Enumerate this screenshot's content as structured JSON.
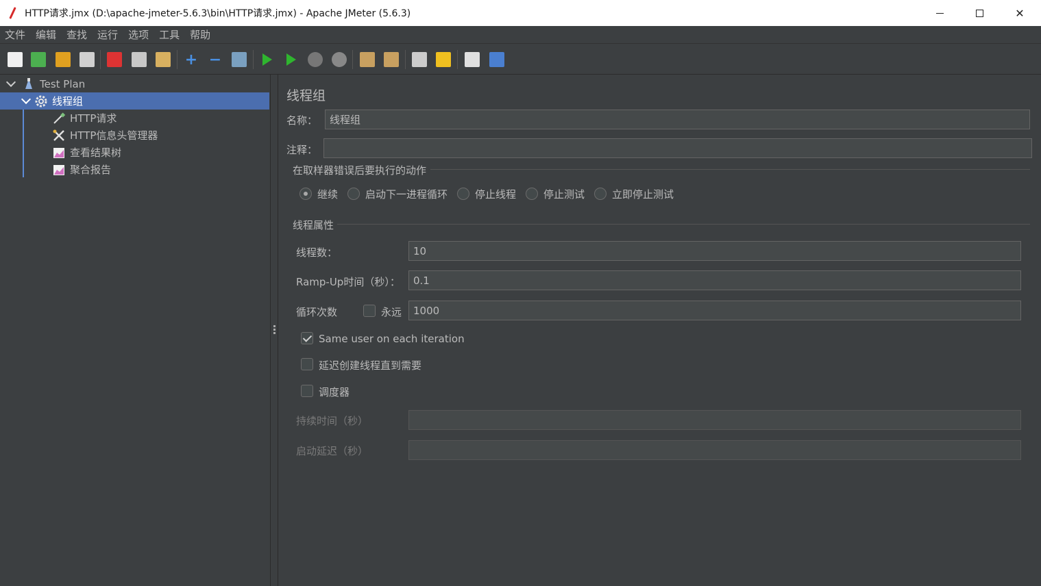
{
  "window": {
    "title": "HTTP请求.jmx (D:\\apache-jmeter-5.6.3\\bin\\HTTP请求.jmx) - Apache JMeter (5.6.3)"
  },
  "menu": [
    "文件",
    "编辑",
    "查找",
    "运行",
    "选项",
    "工具",
    "帮助"
  ],
  "toolbar": [
    {
      "name": "new-icon",
      "color": "#f0f0f0"
    },
    {
      "name": "templates-icon",
      "color": "#4caf50"
    },
    {
      "name": "open-icon",
      "color": "#e0a020"
    },
    {
      "name": "save-icon",
      "color": "#d0d0d0"
    },
    {
      "name": "cut-icon",
      "color": "#d33"
    },
    {
      "name": "copy-icon",
      "color": "#c8c8c8"
    },
    {
      "name": "paste-icon",
      "color": "#d8b060"
    },
    {
      "name": "expand-icon",
      "color": "#4a90e2"
    },
    {
      "name": "collapse-icon",
      "color": "#4a90e2"
    },
    {
      "name": "toggle-icon",
      "color": "#7aa0c0"
    },
    {
      "name": "start-icon",
      "color": "#2fb52f"
    },
    {
      "name": "start-no-pause-icon",
      "color": "#2fb52f"
    },
    {
      "name": "stop-icon",
      "color": "#777777"
    },
    {
      "name": "shutdown-icon",
      "color": "#888888"
    },
    {
      "name": "clear-icon",
      "color": "#c8a060"
    },
    {
      "name": "clear-all-icon",
      "color": "#c8a060"
    },
    {
      "name": "search-icon",
      "color": "#cccccc"
    },
    {
      "name": "reset-search-icon",
      "color": "#f0c020"
    },
    {
      "name": "function-helper-icon",
      "color": "#e0e0e0"
    },
    {
      "name": "help-icon",
      "color": "#4a7fd0"
    }
  ],
  "tree": {
    "items": [
      {
        "label": "Test Plan"
      },
      {
        "label": "线程组"
      },
      {
        "label": "HTTP请求"
      },
      {
        "label": "HTTP信息头管理器"
      },
      {
        "label": "查看结果树"
      },
      {
        "label": "聚合报告"
      }
    ]
  },
  "panel": {
    "title": "线程组",
    "name_label": "名称：",
    "name_value": "线程组",
    "comment_label": "注释：",
    "comment_value": "",
    "error_group_title": "在取样器错误后要执行的动作",
    "error_actions": [
      {
        "label": "继续",
        "checked": true
      },
      {
        "label": "启动下一进程循环",
        "checked": false
      },
      {
        "label": "停止线程",
        "checked": false
      },
      {
        "label": "停止测试",
        "checked": false
      },
      {
        "label": "立即停止测试",
        "checked": false
      }
    ],
    "thread_group_title": "线程属性",
    "threads_label": "线程数：",
    "threads_value": "10",
    "rampup_label": "Ramp-Up时间（秒）：",
    "rampup_value": "0.1",
    "loop_label": "循环次数",
    "forever_label": "永远",
    "forever_checked": false,
    "loop_value": "1000",
    "same_user_label": "Same user on each iteration",
    "same_user_checked": true,
    "delay_create_label": "延迟创建线程直到需要",
    "delay_create_checked": false,
    "scheduler_label": "调度器",
    "scheduler_checked": false,
    "duration_label": "持续时间（秒）",
    "duration_value": "",
    "startup_delay_label": "启动延迟（秒）",
    "startup_delay_value": ""
  }
}
